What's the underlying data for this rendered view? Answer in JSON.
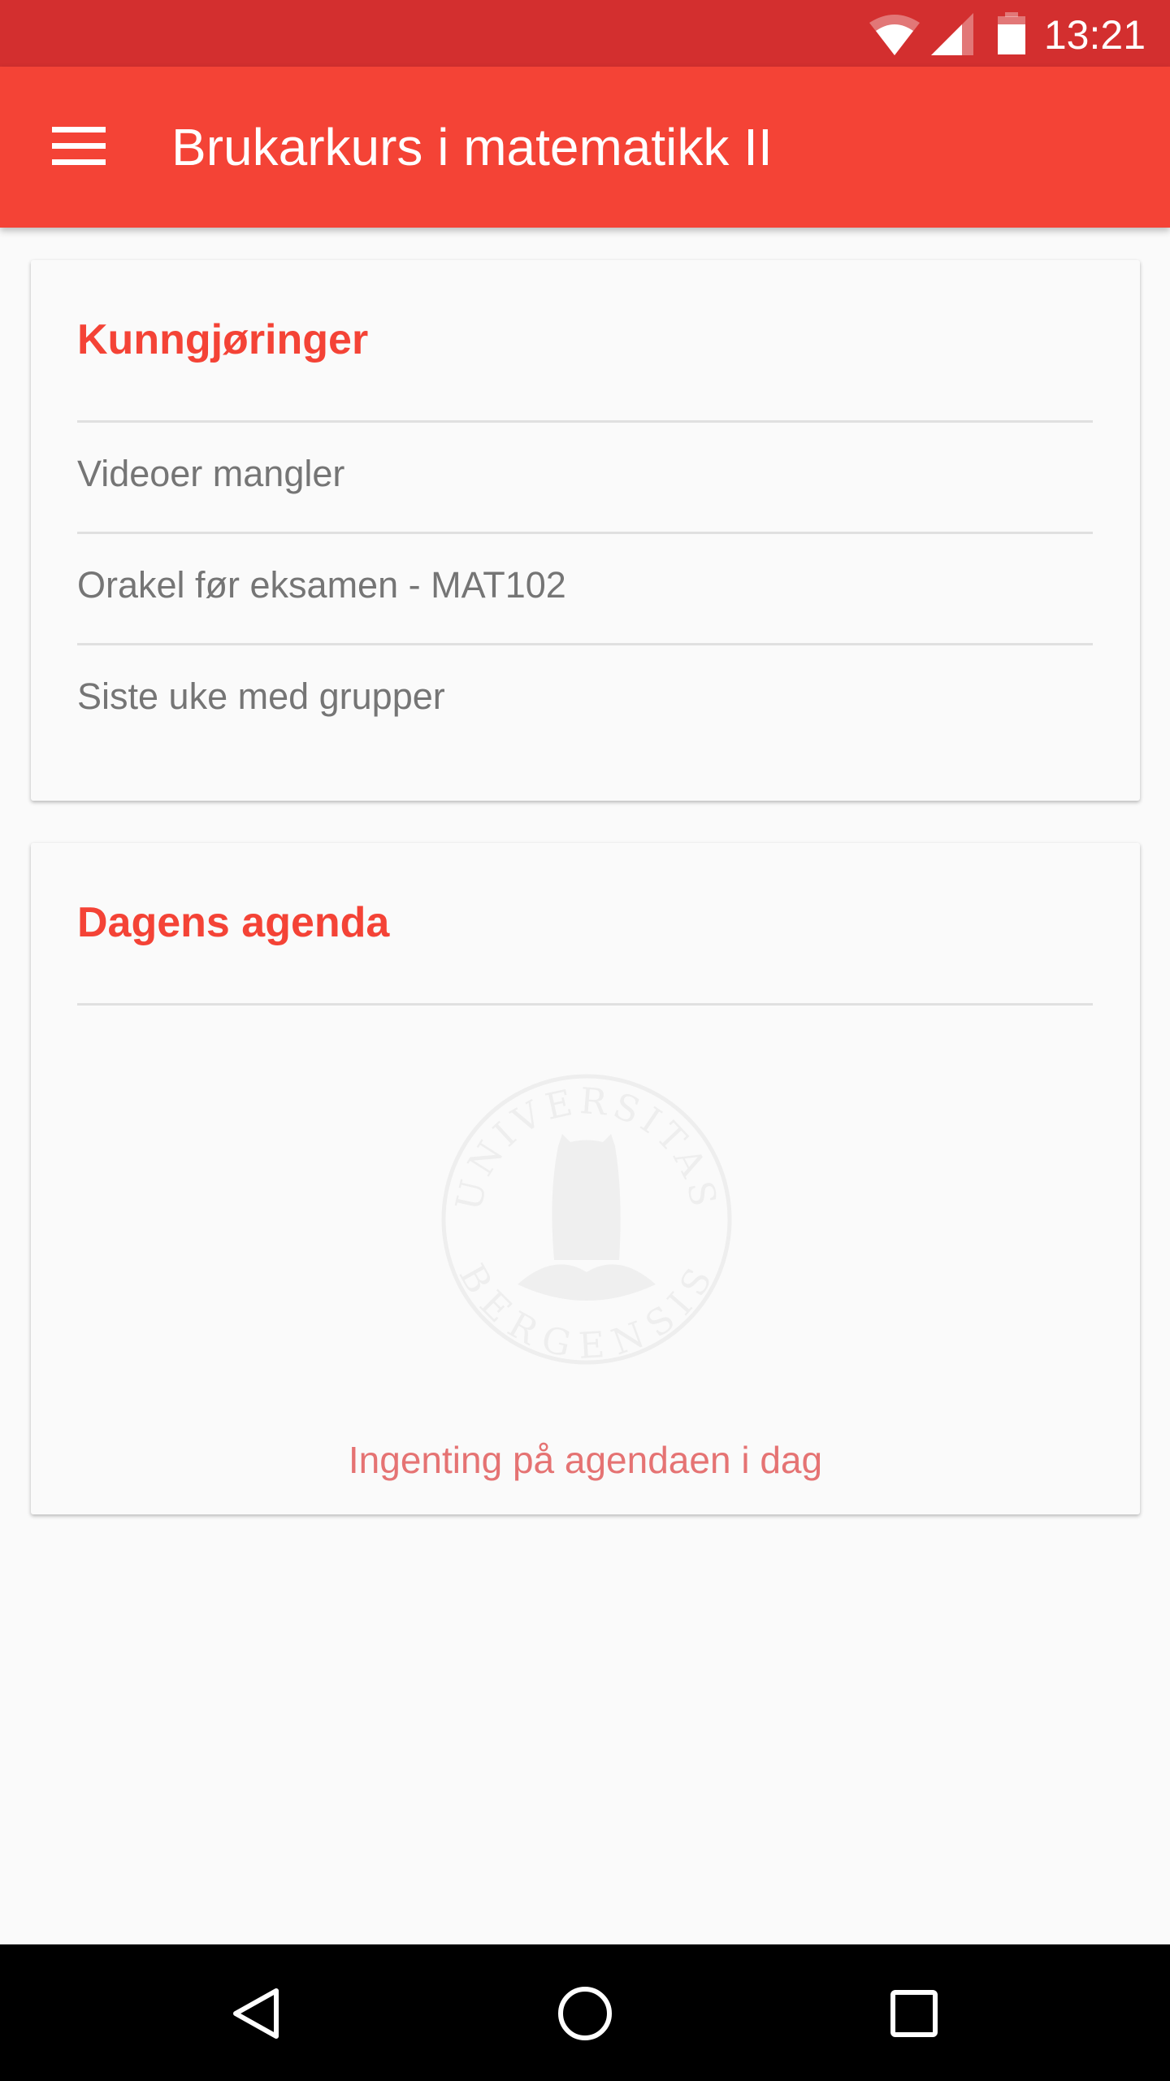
{
  "status_bar": {
    "time": "13:21",
    "icons": [
      "wifi-icon",
      "signal-icon",
      "battery-icon"
    ]
  },
  "app_bar": {
    "title": "Brukarkurs i matematikk II",
    "menu_icon": "hamburger-menu-icon"
  },
  "announcements": {
    "title": "Kunngjøringer",
    "items": [
      {
        "label": "Videoer mangler"
      },
      {
        "label": "Orakel før eksamen - MAT102"
      },
      {
        "label": "Siste uke med grupper"
      }
    ]
  },
  "agenda": {
    "title": "Dagens agenda",
    "empty_text": "Ingenting på agendaen i dag",
    "watermark": "UNIVERSITAS BERGENSIS"
  },
  "colors": {
    "primary": "#f44336",
    "primary_dark": "#d32f2f",
    "empty_text": "#e57373"
  },
  "nav_bar": {
    "icons": [
      "back-icon",
      "home-icon",
      "recents-icon"
    ]
  }
}
